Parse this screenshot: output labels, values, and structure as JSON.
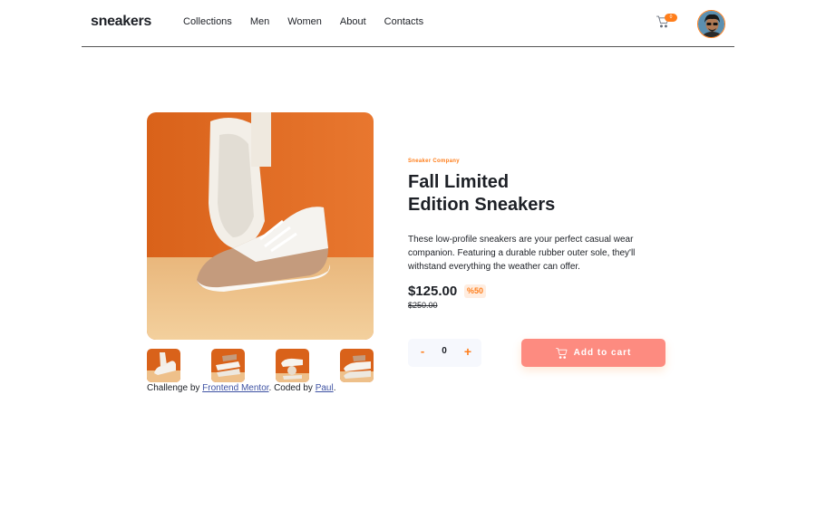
{
  "header": {
    "logo": "sneakers",
    "nav": [
      "Collections",
      "Men",
      "Women",
      "About",
      "Contacts"
    ],
    "cart_count": "0",
    "cart_icon": "cart-icon",
    "avatar_icon": "user-avatar"
  },
  "gallery": {
    "main_image": "white sneaker on orange background",
    "thumbnails": [
      "thumbnail-1",
      "thumbnail-2",
      "thumbnail-3",
      "thumbnail-4"
    ]
  },
  "attribution": {
    "prefix": "Challenge by ",
    "link1": "Frontend Mentor",
    "middle": ". Coded by ",
    "link2": "Paul",
    "suffix": "."
  },
  "product": {
    "company": "Sneaker Company",
    "title_line1": "Fall Limited",
    "title_line2": "Edition Sneakers",
    "description": "These low-profile sneakers are your perfect casual wear companion. Featuring a durable rubber outer sole, they'll withstand everything the weather can offer.",
    "price": "$125.00",
    "discount": "%50",
    "old_price": "$250.00"
  },
  "cart_controls": {
    "minus": "-",
    "quantity": "0",
    "plus": "+",
    "add_label": "Add to cart"
  },
  "colors": {
    "accent": "#ff7e1b",
    "button": "#fd8b80",
    "discount_bg": "#ffede0",
    "text": "#1d2026",
    "qty_bg": "#f6f8fd"
  }
}
